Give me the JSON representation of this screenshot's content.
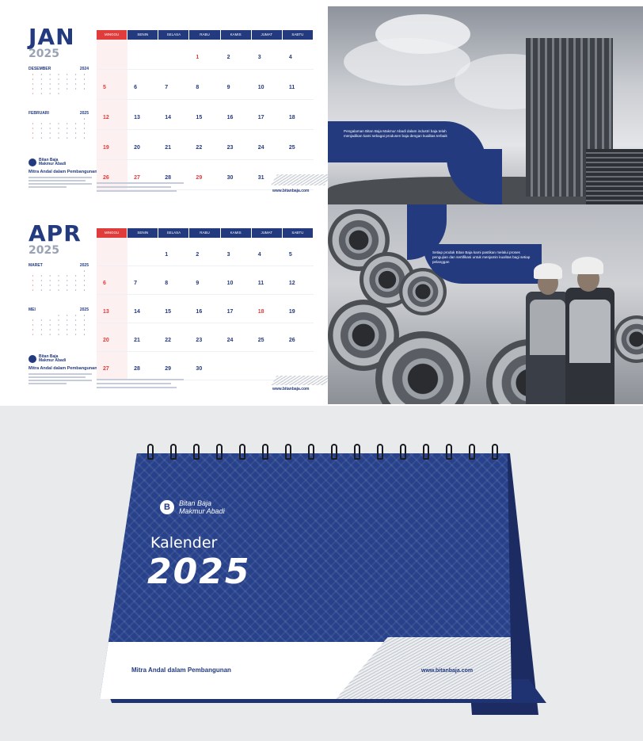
{
  "brand": {
    "name_line1": "Bitan Baja",
    "name_line2": "Makmur Abadi",
    "logo_letter": "B",
    "slogan": "Mitra Andal dalam Pembangunan",
    "website": "www.bitanbaja.com",
    "primary_color": "#233a7e",
    "accent_color": "#e03c3c"
  },
  "weekdays": [
    "MINGGU",
    "SENIN",
    "SELASA",
    "RABU",
    "KAMIS",
    "JUMAT",
    "SABTU"
  ],
  "jan": {
    "month": "JAN",
    "year": "2025",
    "mini1_name": "DESEMBER",
    "mini1_year": "2024",
    "mini2_name": "FEBRUARI",
    "mini2_year": "2025",
    "slogan": "Mitra Andal dalam Pembangunan",
    "website": "www.bitanbaja.com",
    "days": [
      "",
      "",
      "",
      "1",
      "2",
      "3",
      "4",
      "5",
      "6",
      "7",
      "8",
      "9",
      "10",
      "11",
      "12",
      "13",
      "14",
      "15",
      "16",
      "17",
      "18",
      "19",
      "20",
      "21",
      "22",
      "23",
      "24",
      "25",
      "26",
      "27",
      "28",
      "29",
      "30",
      "31",
      ""
    ],
    "holidays": [
      "1",
      "27",
      "29"
    ],
    "photo_caption": "Pengalaman Bitan Baja Makmur Abadi dalam industri baja telah menjadikan kami sebagai produsen baja dengan kualitas terbaik"
  },
  "apr": {
    "month": "APR",
    "year": "2025",
    "mini1_name": "MARET",
    "mini1_year": "2025",
    "mini2_name": "MEI",
    "mini2_year": "2025",
    "slogan": "Mitra Andal dalam Pembangunan",
    "website": "www.bitanbaja.com",
    "days": [
      "",
      "",
      "1",
      "2",
      "3",
      "4",
      "5",
      "6",
      "7",
      "8",
      "9",
      "10",
      "11",
      "12",
      "13",
      "14",
      "15",
      "16",
      "17",
      "18",
      "19",
      "20",
      "21",
      "22",
      "23",
      "24",
      "25",
      "26",
      "27",
      "28",
      "29",
      "30",
      "",
      "",
      ""
    ],
    "holidays": [
      "18"
    ],
    "photo_caption": "Setiap produk Bitan Baja kami pastikan melalui proses pengujian dan sertifikasi untuk menjamin kualitas bagi setiap pelanggan"
  },
  "desk": {
    "title": "Kalender",
    "year": "2025",
    "strip_slogan": "Mitra Andal dalam Pembangunan",
    "strip_website": "www.bitanbaja.com"
  }
}
